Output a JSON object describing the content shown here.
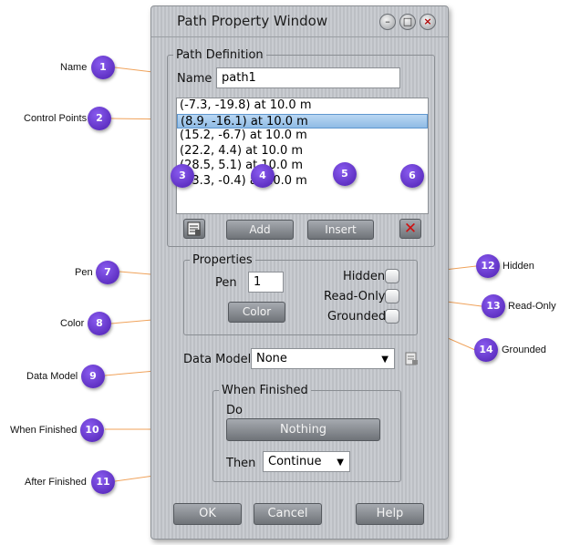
{
  "window": {
    "title": "Path Property Window",
    "controls": [
      "minimize-icon",
      "maximize-icon",
      "close-icon"
    ]
  },
  "path_definition": {
    "legend": "Path Definition",
    "name_label": "Name",
    "name_value": "path1",
    "control_points": [
      "(-7.3, -19.8) at 10.0 m",
      "(8.9, -16.1) at 10.0 m",
      "(15.2, -6.7) at 10.0 m",
      "(22.2, 4.4) at 10.0 m",
      "(28.5, 5.1) at 10.0 m",
      "(33.3, -0.4) at 10.0 m"
    ],
    "selected_index": 1,
    "add_label": "Add",
    "insert_label": "Insert"
  },
  "properties": {
    "legend": "Properties",
    "pen_label": "Pen",
    "pen_value": "1",
    "color_label": "Color",
    "hidden_label": "Hidden",
    "readonly_label": "Read-Only",
    "grounded_label": "Grounded"
  },
  "data_model": {
    "label": "Data Model",
    "value": "None"
  },
  "when_finished": {
    "legend": "When Finished",
    "do_label": "Do",
    "do_value": "Nothing",
    "then_label": "Then",
    "then_value": "Continue"
  },
  "footer": {
    "ok_label": "OK",
    "cancel_label": "Cancel",
    "help_label": "Help"
  },
  "annotations": [
    {
      "num": "1",
      "text": "Name"
    },
    {
      "num": "2",
      "text": "Control Points"
    },
    {
      "num": "3",
      "text": ""
    },
    {
      "num": "4",
      "text": ""
    },
    {
      "num": "5",
      "text": ""
    },
    {
      "num": "6",
      "text": ""
    },
    {
      "num": "7",
      "text": "Pen"
    },
    {
      "num": "8",
      "text": "Color"
    },
    {
      "num": "9",
      "text": "Data Model"
    },
    {
      "num": "10",
      "text": "When Finished"
    },
    {
      "num": "11",
      "text": "After Finished"
    },
    {
      "num": "12",
      "text": "Hidden"
    },
    {
      "num": "13",
      "text": "Read-Only"
    },
    {
      "num": "14",
      "text": "Grounded"
    }
  ],
  "colors": {
    "badge": "#5a2cc9",
    "leader_line": "#f0a25a",
    "selection": "#9cc5ee",
    "window_bg": "#c4c7cc"
  }
}
